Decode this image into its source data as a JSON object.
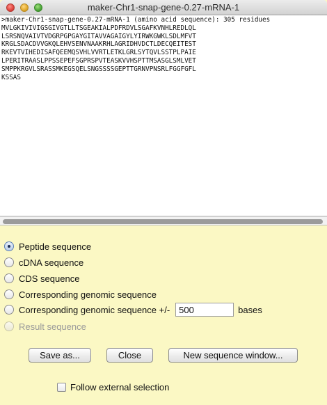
{
  "window": {
    "title": "maker-Chr1-snap-gene-0.27-mRNA-1"
  },
  "sequence": {
    "text": ">maker-Chr1-snap-gene-0.27-mRNA-1 (amino acid sequence): 305 residues\nMVLGKIVIVIGSGIVGTLLTSGEAKIALPDFRDVLSGAFKVNHLREDLQL\nLSRSNQVAIVTVDGRPGPGAYGITAVVAGAIGYLYIRWKGWKLSDLMFVT\nKRGLSDACDVVGKQLEHVSENVNAAKRHLAGRIDHVDCTLDECQEITEST\nRKEVTVIHEDISAFQEEMQSVHLVVRTLETKLGRLSYTQVLSSTPLPAIE\nLPERITRAASLPPSSEPEFSGPRSPVTEASKVVHSPTTMSASGLSMLVET\nSMPPKRGVLSRASSMKEGSQELSNGSSSSGEPTTGRNVPNSRLFGGFGFL\nKSSAS"
  },
  "options": {
    "peptide": "Peptide sequence",
    "cdna": "cDNA sequence",
    "cds": "CDS sequence",
    "genomic": "Corresponding genomic sequence",
    "genomic_plus_minus": "Corresponding genomic sequence +/-",
    "bases_value": "500",
    "bases_label": "bases",
    "result": "Result sequence",
    "selected": "peptide"
  },
  "buttons": {
    "save_as": "Save as...",
    "close": "Close",
    "new_window": "New sequence window..."
  },
  "follow_external_selection": {
    "label": "Follow external selection",
    "checked": false
  }
}
